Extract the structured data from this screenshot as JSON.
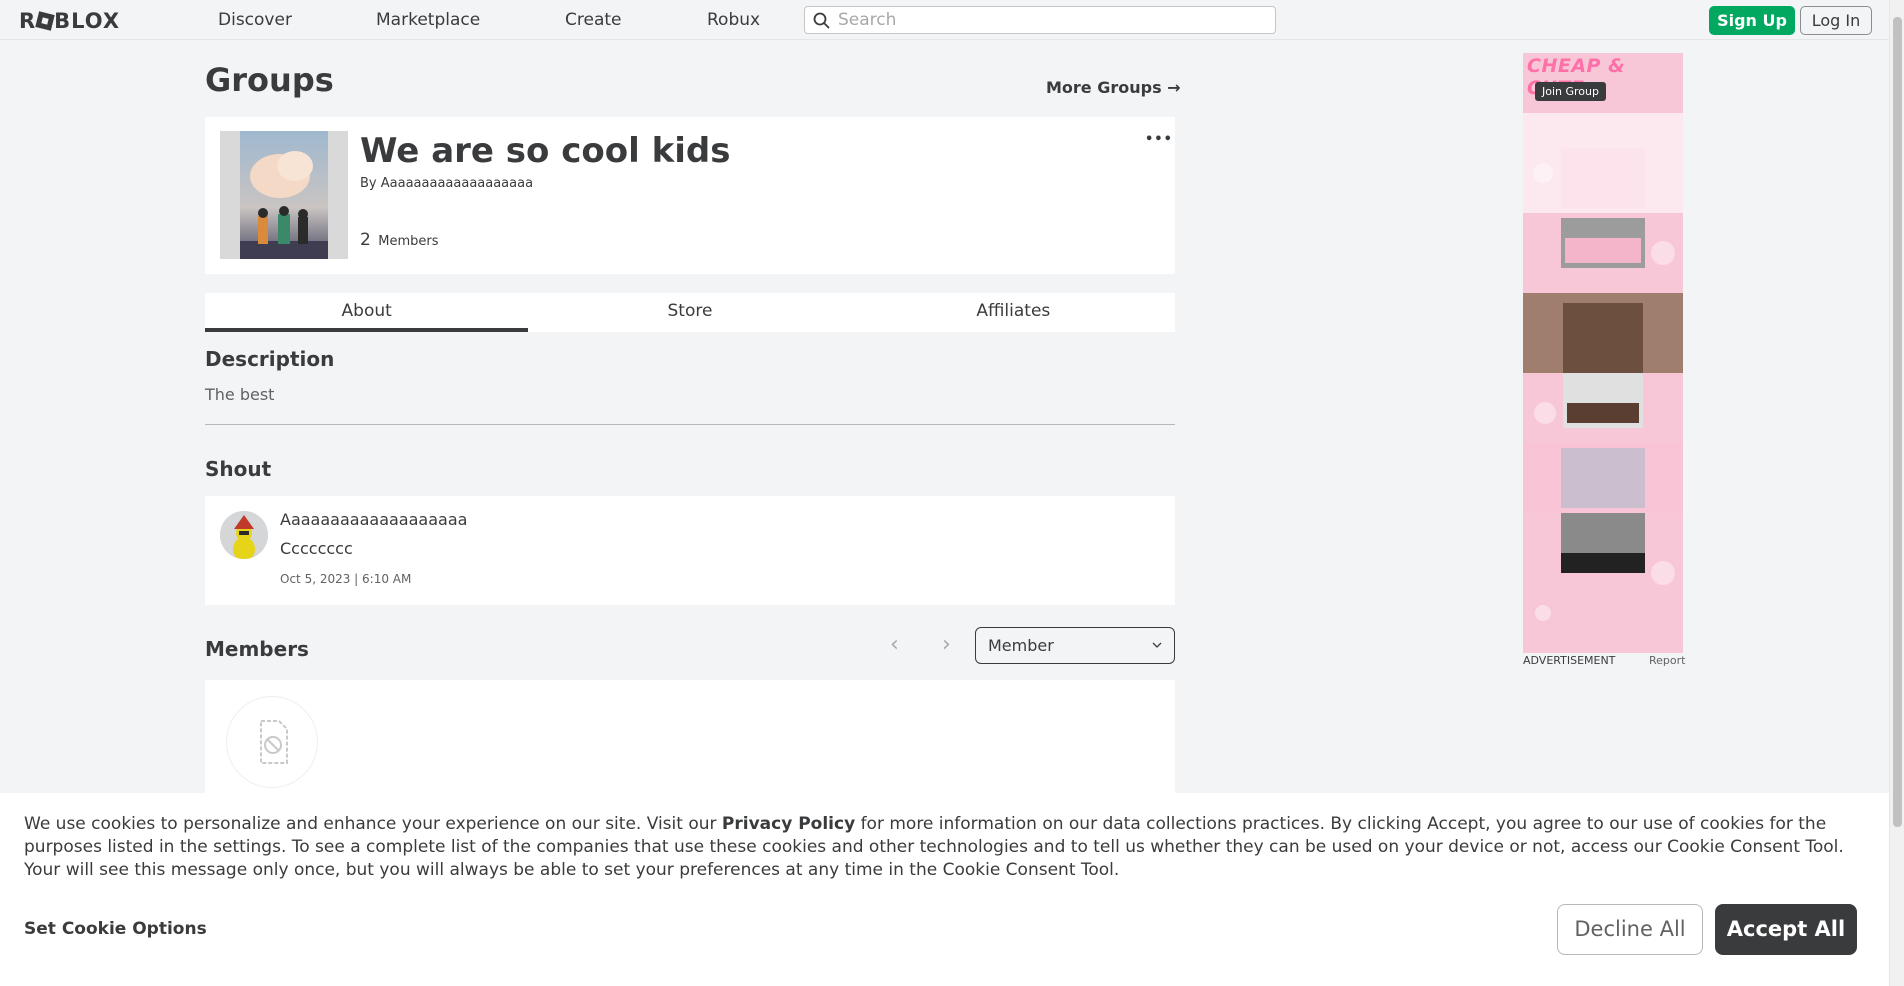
{
  "nav": {
    "logo": "RBLOX",
    "links": [
      "Discover",
      "Marketplace",
      "Create",
      "Robux"
    ],
    "search_placeholder": "Search",
    "signup_label": "Sign Up",
    "login_label": "Log In"
  },
  "page": {
    "title": "Groups",
    "more_groups": "More Groups →"
  },
  "group": {
    "name": "We are so cool kids",
    "by_prefix": "By",
    "owner": "Aaaaaaaaaaaaaaaaaaa",
    "member_count": "2",
    "members_label": "Members",
    "menu_dots": "•••"
  },
  "tabs": [
    "About",
    "Store",
    "Affiliates"
  ],
  "active_tab": "About",
  "description": {
    "title": "Description",
    "text": "The best"
  },
  "shout": {
    "title": "Shout",
    "user": "Aaaaaaaaaaaaaaaaaaa",
    "text": "Cccccccc",
    "date": "Oct 5, 2023 | 6:10 AM"
  },
  "members": {
    "title": "Members",
    "prev": "‹",
    "next": "›",
    "role_selected": "Member"
  },
  "ad": {
    "title": "CHEAP & CUTE",
    "button": "Join Group",
    "label": "ADVERTISEMENT",
    "report": "Report"
  },
  "cookie": {
    "text_before": "We use cookies to personalize and enhance your experience on our site. Visit our ",
    "link": "Privacy Policy",
    "text_after": " for more information on our data collections practices. By clicking Accept, you agree to our use of cookies for the purposes listed in the settings. To see a complete list of the companies that use these cookies and other technologies and to tell us whether they can be used on your device or not, access our Cookie Consent Tool. Your will see this message only once, but you will always be able to set your preferences at any time in the Cookie Consent Tool.",
    "set_options": "Set Cookie Options",
    "decline": "Decline All",
    "accept": "Accept All"
  },
  "colors": {
    "accent_green": "#00a95f",
    "text_dark": "#393b3d",
    "page_bg": "#f2f4f5"
  }
}
